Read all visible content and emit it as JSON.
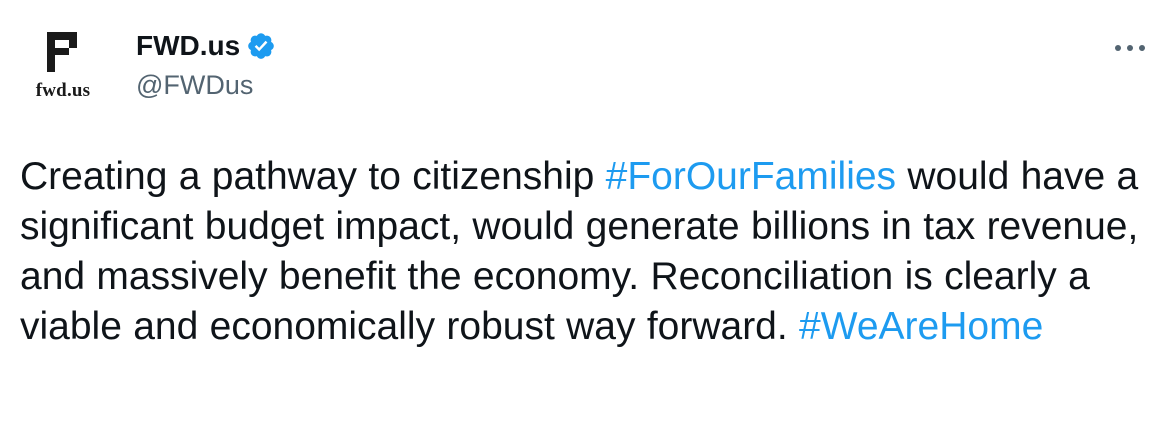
{
  "author": {
    "avatar_text": "fwd.us",
    "display_name": "FWD.us",
    "handle": "@FWDus",
    "verified": true
  },
  "tweet": {
    "segments": [
      {
        "text": "Creating a pathway to citizenship ",
        "type": "text"
      },
      {
        "text": "#ForOurFamilies",
        "type": "hashtag"
      },
      {
        "text": " would have a significant budget impact, would generate billions in tax revenue, and massively benefit the economy. Reconciliation is clearly a viable and economically robust way forward. ",
        "type": "text"
      },
      {
        "text": "#WeAreHome",
        "type": "hashtag"
      }
    ]
  },
  "icons": {
    "verified": "verified-badge-icon",
    "more": "more-options-icon"
  },
  "colors": {
    "hashtag": "#1d9bf0",
    "text": "#0f1419",
    "handle": "#536471",
    "verified": "#1d9bf0"
  }
}
